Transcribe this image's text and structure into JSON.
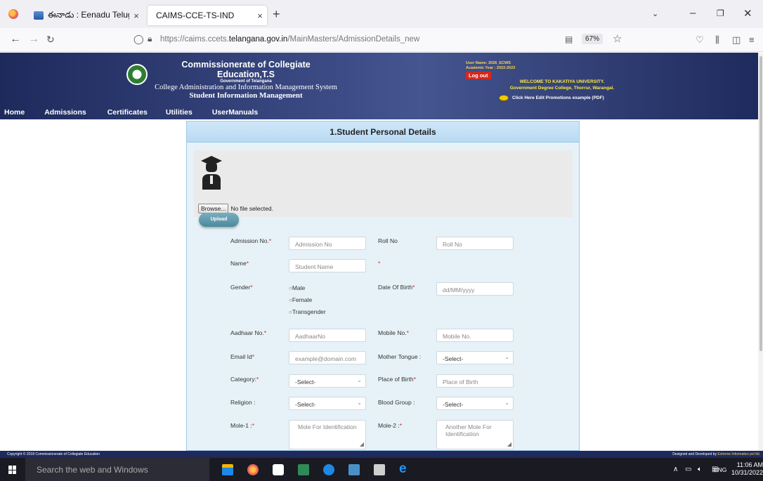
{
  "browser": {
    "tabs": [
      {
        "title": "ఈనాడు : Eenadu Telugu News P…",
        "close": "×"
      },
      {
        "title": "CAIMS-CCE-TS-IND",
        "close": "×"
      }
    ],
    "new_tab": "+",
    "url_prefix": "https://caims.ccets.",
    "url_domain": "telangana.gov.in",
    "url_path": "/MainMasters/AdmissionDetails_new",
    "zoom": "67%"
  },
  "header": {
    "title": "Commissionerate of Collegiate Education,T.S",
    "gov": "Government of Telangana",
    "system": "College Administration and Information Management System",
    "subsystem": "Student Information Management",
    "user_name": "User Name: 2026_ECWS",
    "academic_year": "Academic Year : 2022-2023",
    "logout": "Log out",
    "welcome": "WELCOME TO KAKATIYA UNIVERSITY.",
    "college": "Government Degree College, Thorrur, Warangal.",
    "promo_link": "Click Here Edit Promotions example (PDF)"
  },
  "menu": [
    "Home",
    "Admissions",
    "Certificates",
    "Utilities",
    "UserManuals"
  ],
  "form": {
    "section_title": "1.Student Personal Details",
    "browse_label": "Browse...",
    "file_status": "No file selected.",
    "upload_label": "Upload",
    "admission_no": {
      "label": "Admission No.",
      "placeholder": "Admission No"
    },
    "roll_no": {
      "label": "Roll No",
      "placeholder": "Roll No"
    },
    "name": {
      "label": "Name",
      "placeholder": "Student Name"
    },
    "gender": {
      "label": "Gender",
      "options": [
        "Male",
        "Female",
        "Transgender"
      ]
    },
    "dob": {
      "label": "Date Of Birth",
      "placeholder": "dd/MM/yyyy"
    },
    "aadhaar": {
      "label": "Aadhaar No.",
      "placeholder": "AadhaarNo"
    },
    "mobile": {
      "label": "Mobile No.",
      "placeholder": "Mobile No."
    },
    "email": {
      "label": "Email Id",
      "placeholder": "example@domain.com"
    },
    "mother_tongue": {
      "label": "Mother Tongue :",
      "value": "-Select-"
    },
    "category": {
      "label": "Category:",
      "value": "-Select-"
    },
    "place_of_birth": {
      "label": "Place of Birth",
      "placeholder": "Place of Birth"
    },
    "religion": {
      "label": "Religion :",
      "value": "-Select-"
    },
    "blood_group": {
      "label": "Blood Group :",
      "value": "-Select-"
    },
    "mole1": {
      "label": "Mole-1 :",
      "placeholder": "Mole For Identification"
    },
    "mole2": {
      "label": "Mole-2 :",
      "placeholder": "Another Mole For Identification"
    }
  },
  "footer": {
    "copyright": "Copyright © 2018 Commissionerate of Collegiate Education",
    "developer_prefix": "Designed and Developed by ",
    "developer": "Extreme Informatics pvt ltd."
  },
  "taskbar": {
    "search": "Search the web and Windows",
    "lang": "ENG",
    "time": "11:06 AM",
    "date": "10/31/2022"
  }
}
